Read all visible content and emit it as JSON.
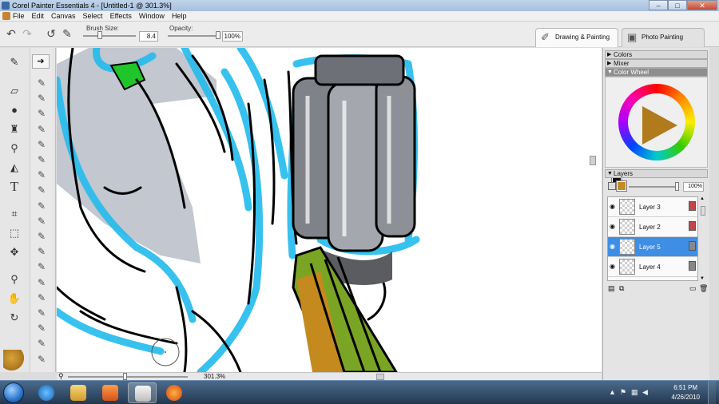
{
  "window": {
    "title": "Corel Painter Essentials 4 - [Untitled-1 @ 301.3%]",
    "controls": {
      "minimize": "–",
      "maximize": "□",
      "close": "✕"
    }
  },
  "menu": [
    "File",
    "Edit",
    "Canvas",
    "Select",
    "Effects",
    "Window",
    "Help"
  ],
  "property_bar": {
    "brush_size_label": "Brush Size:",
    "brush_size_value": "8.4",
    "brush_size_fraction": 0.3,
    "opacity_label": "Opacity:",
    "opacity_value": "100%",
    "opacity_fraction": 1.0,
    "undo_icon": "undo-icon",
    "redo_icon": "redo-icon"
  },
  "workspace_tabs": [
    {
      "label": "Drawing & Painting",
      "active": true,
      "icon": "brush-icon"
    },
    {
      "label": "Photo Painting",
      "active": false,
      "icon": "photo-icon"
    }
  ],
  "toolbox": {
    "tools": [
      "brush-tool-icon",
      "eraser-icon",
      "blend-icon",
      "clone-stamp-icon",
      "dropper-icon",
      "paint-bucket-icon",
      "text-tool-icon",
      "crop-icon",
      "rect-selection-icon",
      "transform-icon",
      "magnifier-icon",
      "grabber-hand-icon",
      "rotate-page-icon"
    ],
    "brush_variant_count": 19
  },
  "canvas": {
    "zoom_label": "301.3%",
    "zoom_fraction": 0.48
  },
  "panels": {
    "colors_label": "Colors",
    "mixer_label": "Mixer",
    "color_wheel_label": "Color Wheel",
    "main_color": "#000000",
    "additional_color": "#c58b23",
    "layers_label": "Layers",
    "layer_opacity": "100%",
    "layers": [
      {
        "name": "Layer 3",
        "selected": false
      },
      {
        "name": "Layer 2",
        "selected": false
      },
      {
        "name": "Layer 5",
        "selected": true
      },
      {
        "name": "Layer 4",
        "selected": false
      }
    ]
  },
  "taskbar": {
    "time": "6:51 PM",
    "date": "4/26/2010",
    "pinned": [
      "internet-explorer-icon",
      "explorer-folder-icon",
      "media-player-icon",
      "painter-icon",
      "firefox-icon"
    ]
  }
}
